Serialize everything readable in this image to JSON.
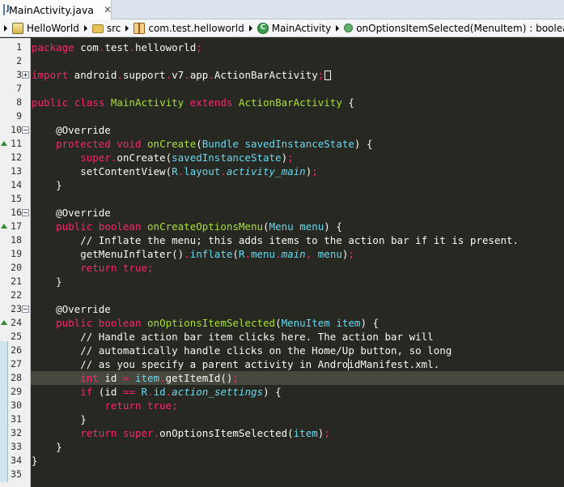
{
  "tab": {
    "title": "MainActivity.java",
    "close": "✕"
  },
  "breadcrumb": [
    {
      "label": "HelloWorld",
      "icon": "project-icon"
    },
    {
      "label": "src",
      "icon": "source-folder-icon"
    },
    {
      "label": "com.test.helloworld",
      "icon": "package-icon"
    },
    {
      "label": "MainActivity",
      "icon": "class-icon"
    },
    {
      "label": "onOptionsItemSelected(MenuItem) : boolean",
      "icon": "public-method-icon"
    }
  ],
  "editor": {
    "current_line": 28,
    "colors": {
      "background": "#272822",
      "keyword": "#f92672",
      "type": "#66d9ef",
      "function": "#a6e22e",
      "text": "#f8f8f2",
      "current_line": "#49483e"
    },
    "lines": [
      {
        "n": "1",
        "tokens": [
          [
            "kw",
            "package"
          ],
          [
            "pl",
            " com"
          ],
          [
            "op",
            "."
          ],
          [
            "pl",
            "test"
          ],
          [
            "op",
            "."
          ],
          [
            "pl",
            "helloworld"
          ],
          [
            "op",
            ";"
          ]
        ]
      },
      {
        "n": "2",
        "tokens": []
      },
      {
        "n": "3",
        "tokens": [
          [
            "kw",
            "import"
          ],
          [
            "pl",
            " android"
          ],
          [
            "op",
            "."
          ],
          [
            "pl",
            "support"
          ],
          [
            "op",
            "."
          ],
          [
            "pl",
            "v7"
          ],
          [
            "op",
            "."
          ],
          [
            "pl",
            "app"
          ],
          [
            "op",
            "."
          ],
          [
            "pl",
            "ActionBarActivity"
          ],
          [
            "op",
            ";"
          ],
          [
            "box",
            ""
          ]
        ]
      },
      {
        "n": "7",
        "tokens": []
      },
      {
        "n": "8",
        "tokens": [
          [
            "kw",
            "public"
          ],
          [
            "pl",
            " "
          ],
          [
            "kw",
            "class"
          ],
          [
            "pl",
            " "
          ],
          [
            "fn",
            "MainActivity"
          ],
          [
            "pl",
            " "
          ],
          [
            "kw",
            "extends"
          ],
          [
            "pl",
            " "
          ],
          [
            "fn",
            "ActionBarActivity"
          ],
          [
            "pl",
            " {"
          ]
        ]
      },
      {
        "n": "9",
        "tokens": []
      },
      {
        "n": "10",
        "tokens": [
          [
            "pl",
            "    @Override"
          ]
        ]
      },
      {
        "n": "11",
        "tokens": [
          [
            "pl",
            "    "
          ],
          [
            "kw",
            "protected"
          ],
          [
            "pl",
            " "
          ],
          [
            "kw",
            "void"
          ],
          [
            "pl",
            " "
          ],
          [
            "fn",
            "onCreate"
          ],
          [
            "pl",
            "("
          ],
          [
            "ty",
            "Bundle"
          ],
          [
            "pl",
            " "
          ],
          [
            "ty",
            "savedInstanceState"
          ],
          [
            "pl",
            ") {"
          ]
        ]
      },
      {
        "n": "12",
        "tokens": [
          [
            "pl",
            "        "
          ],
          [
            "kw",
            "super"
          ],
          [
            "op",
            "."
          ],
          [
            "pl",
            "onCreate("
          ],
          [
            "ty",
            "savedInstanceState"
          ],
          [
            "pl",
            ")"
          ],
          [
            "op",
            ";"
          ]
        ]
      },
      {
        "n": "13",
        "tokens": [
          [
            "pl",
            "        setContentView("
          ],
          [
            "ty",
            "R"
          ],
          [
            "op",
            "."
          ],
          [
            "ty",
            "layout"
          ],
          [
            "op",
            "."
          ],
          [
            "ity",
            "activity_main"
          ],
          [
            "pl",
            ")"
          ],
          [
            "op",
            ";"
          ]
        ]
      },
      {
        "n": "14",
        "tokens": [
          [
            "pl",
            "    }"
          ]
        ]
      },
      {
        "n": "15",
        "tokens": []
      },
      {
        "n": "16",
        "tokens": [
          [
            "pl",
            "    @Override"
          ]
        ]
      },
      {
        "n": "17",
        "tokens": [
          [
            "pl",
            "    "
          ],
          [
            "kw",
            "public"
          ],
          [
            "pl",
            " "
          ],
          [
            "kw",
            "boolean"
          ],
          [
            "pl",
            " "
          ],
          [
            "fn",
            "onCreateOptionsMenu"
          ],
          [
            "pl",
            "("
          ],
          [
            "ty",
            "Menu"
          ],
          [
            "pl",
            " "
          ],
          [
            "ty",
            "menu"
          ],
          [
            "pl",
            ") {"
          ]
        ]
      },
      {
        "n": "18",
        "tokens": [
          [
            "cm",
            "        // Inflate the menu; this adds items to the action bar if it is present."
          ]
        ]
      },
      {
        "n": "19",
        "tokens": [
          [
            "pl",
            "        getMenuInflater()"
          ],
          [
            "op",
            "."
          ],
          [
            "ty",
            "inflate"
          ],
          [
            "pl",
            "("
          ],
          [
            "ty",
            "R"
          ],
          [
            "op",
            "."
          ],
          [
            "ty",
            "menu"
          ],
          [
            "op",
            "."
          ],
          [
            "ity",
            "main"
          ],
          [
            "op",
            ","
          ],
          [
            "pl",
            " "
          ],
          [
            "ty",
            "menu"
          ],
          [
            "pl",
            ")"
          ],
          [
            "op",
            ";"
          ]
        ]
      },
      {
        "n": "20",
        "tokens": [
          [
            "pl",
            "        "
          ],
          [
            "kw",
            "return"
          ],
          [
            "pl",
            " "
          ],
          [
            "kw",
            "true"
          ],
          [
            "op",
            ";"
          ]
        ]
      },
      {
        "n": "21",
        "tokens": [
          [
            "pl",
            "    }"
          ]
        ]
      },
      {
        "n": "22",
        "tokens": []
      },
      {
        "n": "23",
        "tokens": [
          [
            "pl",
            "    @Override"
          ]
        ]
      },
      {
        "n": "24",
        "tokens": [
          [
            "pl",
            "    "
          ],
          [
            "kw",
            "public"
          ],
          [
            "pl",
            " "
          ],
          [
            "kw",
            "boolean"
          ],
          [
            "pl",
            " "
          ],
          [
            "fn",
            "onOptionsItemSelected"
          ],
          [
            "pl",
            "("
          ],
          [
            "ty",
            "MenuItem"
          ],
          [
            "pl",
            " "
          ],
          [
            "ty",
            "item"
          ],
          [
            "pl",
            ") {"
          ]
        ]
      },
      {
        "n": "25",
        "tokens": [
          [
            "cm",
            "        // Handle action bar item clicks here. The action bar will"
          ]
        ]
      },
      {
        "n": "26",
        "tokens": [
          [
            "cm",
            "        // automatically handle clicks on the Home/Up button, so long"
          ]
        ]
      },
      {
        "n": "27",
        "tokens": [
          [
            "cm",
            "        // as you specify a parent activity in AndroidManifest.xml."
          ]
        ]
      },
      {
        "n": "28",
        "tokens": [
          [
            "pl",
            "        "
          ],
          [
            "kw",
            "int"
          ],
          [
            "pl",
            " id "
          ],
          [
            "op",
            "="
          ],
          [
            "pl",
            " "
          ],
          [
            "ty",
            "item"
          ],
          [
            "op",
            "."
          ],
          [
            "pl",
            "getItemId()"
          ],
          [
            "op",
            ";"
          ]
        ]
      },
      {
        "n": "29",
        "tokens": [
          [
            "pl",
            "        "
          ],
          [
            "kw",
            "if"
          ],
          [
            "pl",
            " (id "
          ],
          [
            "op",
            "=="
          ],
          [
            "pl",
            " "
          ],
          [
            "ty",
            "R"
          ],
          [
            "op",
            "."
          ],
          [
            "ty",
            "id"
          ],
          [
            "op",
            "."
          ],
          [
            "ity",
            "action_settings"
          ],
          [
            "pl",
            ") {"
          ]
        ]
      },
      {
        "n": "30",
        "tokens": [
          [
            "pl",
            "            "
          ],
          [
            "kw",
            "return"
          ],
          [
            "pl",
            " "
          ],
          [
            "kw",
            "true"
          ],
          [
            "op",
            ";"
          ]
        ]
      },
      {
        "n": "31",
        "tokens": [
          [
            "pl",
            "        }"
          ]
        ]
      },
      {
        "n": "32",
        "tokens": [
          [
            "pl",
            "        "
          ],
          [
            "kw",
            "return"
          ],
          [
            "pl",
            " "
          ],
          [
            "kw",
            "super"
          ],
          [
            "op",
            "."
          ],
          [
            "pl",
            "onOptionsItemSelected("
          ],
          [
            "ty",
            "item"
          ],
          [
            "pl",
            ")"
          ],
          [
            "op",
            ";"
          ]
        ]
      },
      {
        "n": "33",
        "tokens": [
          [
            "pl",
            "    }"
          ]
        ]
      },
      {
        "n": "34",
        "tokens": [
          [
            "pl",
            "}"
          ]
        ]
      },
      {
        "n": "35",
        "tokens": []
      }
    ]
  }
}
